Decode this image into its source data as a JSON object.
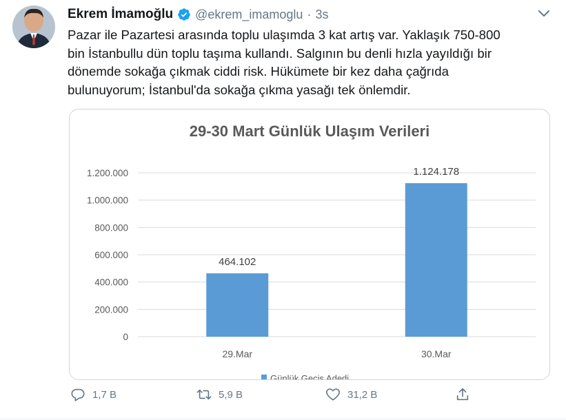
{
  "author": {
    "name": "Ekrem İmamoğlu",
    "handle": "@ekrem_imamoglu",
    "separator": "·",
    "time": "3s"
  },
  "tweet": {
    "lines": [
      "Pazar ile Pazartesi arasında toplu ulaşımda 3 kat artış var. Yaklaşık 750-800",
      "bin İstanbullu dün toplu taşıma kullandı. Salgının bu denli hızla yayıldığı bir",
      "dönemde sokağa çıkmak ciddi risk. Hükümete bir kez daha çağrıda",
      "bulunuyorum; İstanbul'da sokağa çıkma yasağı tek önlemdir."
    ]
  },
  "chart_data": {
    "type": "bar",
    "title": "29-30 Mart Günlük Ulaşım Verileri",
    "categories": [
      "29.Mar",
      "30.Mar"
    ],
    "series": [
      {
        "name": "Günlük Geçiş Adedi",
        "values": [
          464102,
          1124178
        ]
      }
    ],
    "data_labels": [
      "464.102",
      "1.124.178"
    ],
    "ylim": [
      0,
      1200000
    ],
    "yticks": [
      0,
      200000,
      400000,
      600000,
      800000,
      1000000,
      1200000
    ],
    "ytick_labels": [
      "0",
      "200.000",
      "400.000",
      "600.000",
      "800.000",
      "1.000.000",
      "1.200.000"
    ],
    "grid": true,
    "legend": "bottom",
    "bar_color": "#5b9bd5"
  },
  "actions": {
    "reply": {
      "icon": "reply-icon",
      "count": "1,7 B"
    },
    "retweet": {
      "icon": "retweet-icon",
      "count": "5,9 B"
    },
    "like": {
      "icon": "heart-icon",
      "count": "31,2 B"
    },
    "share": {
      "icon": "share-icon"
    }
  },
  "colors": {
    "verified": "#1da1f2",
    "muted": "#657786",
    "text": "#14171a"
  }
}
